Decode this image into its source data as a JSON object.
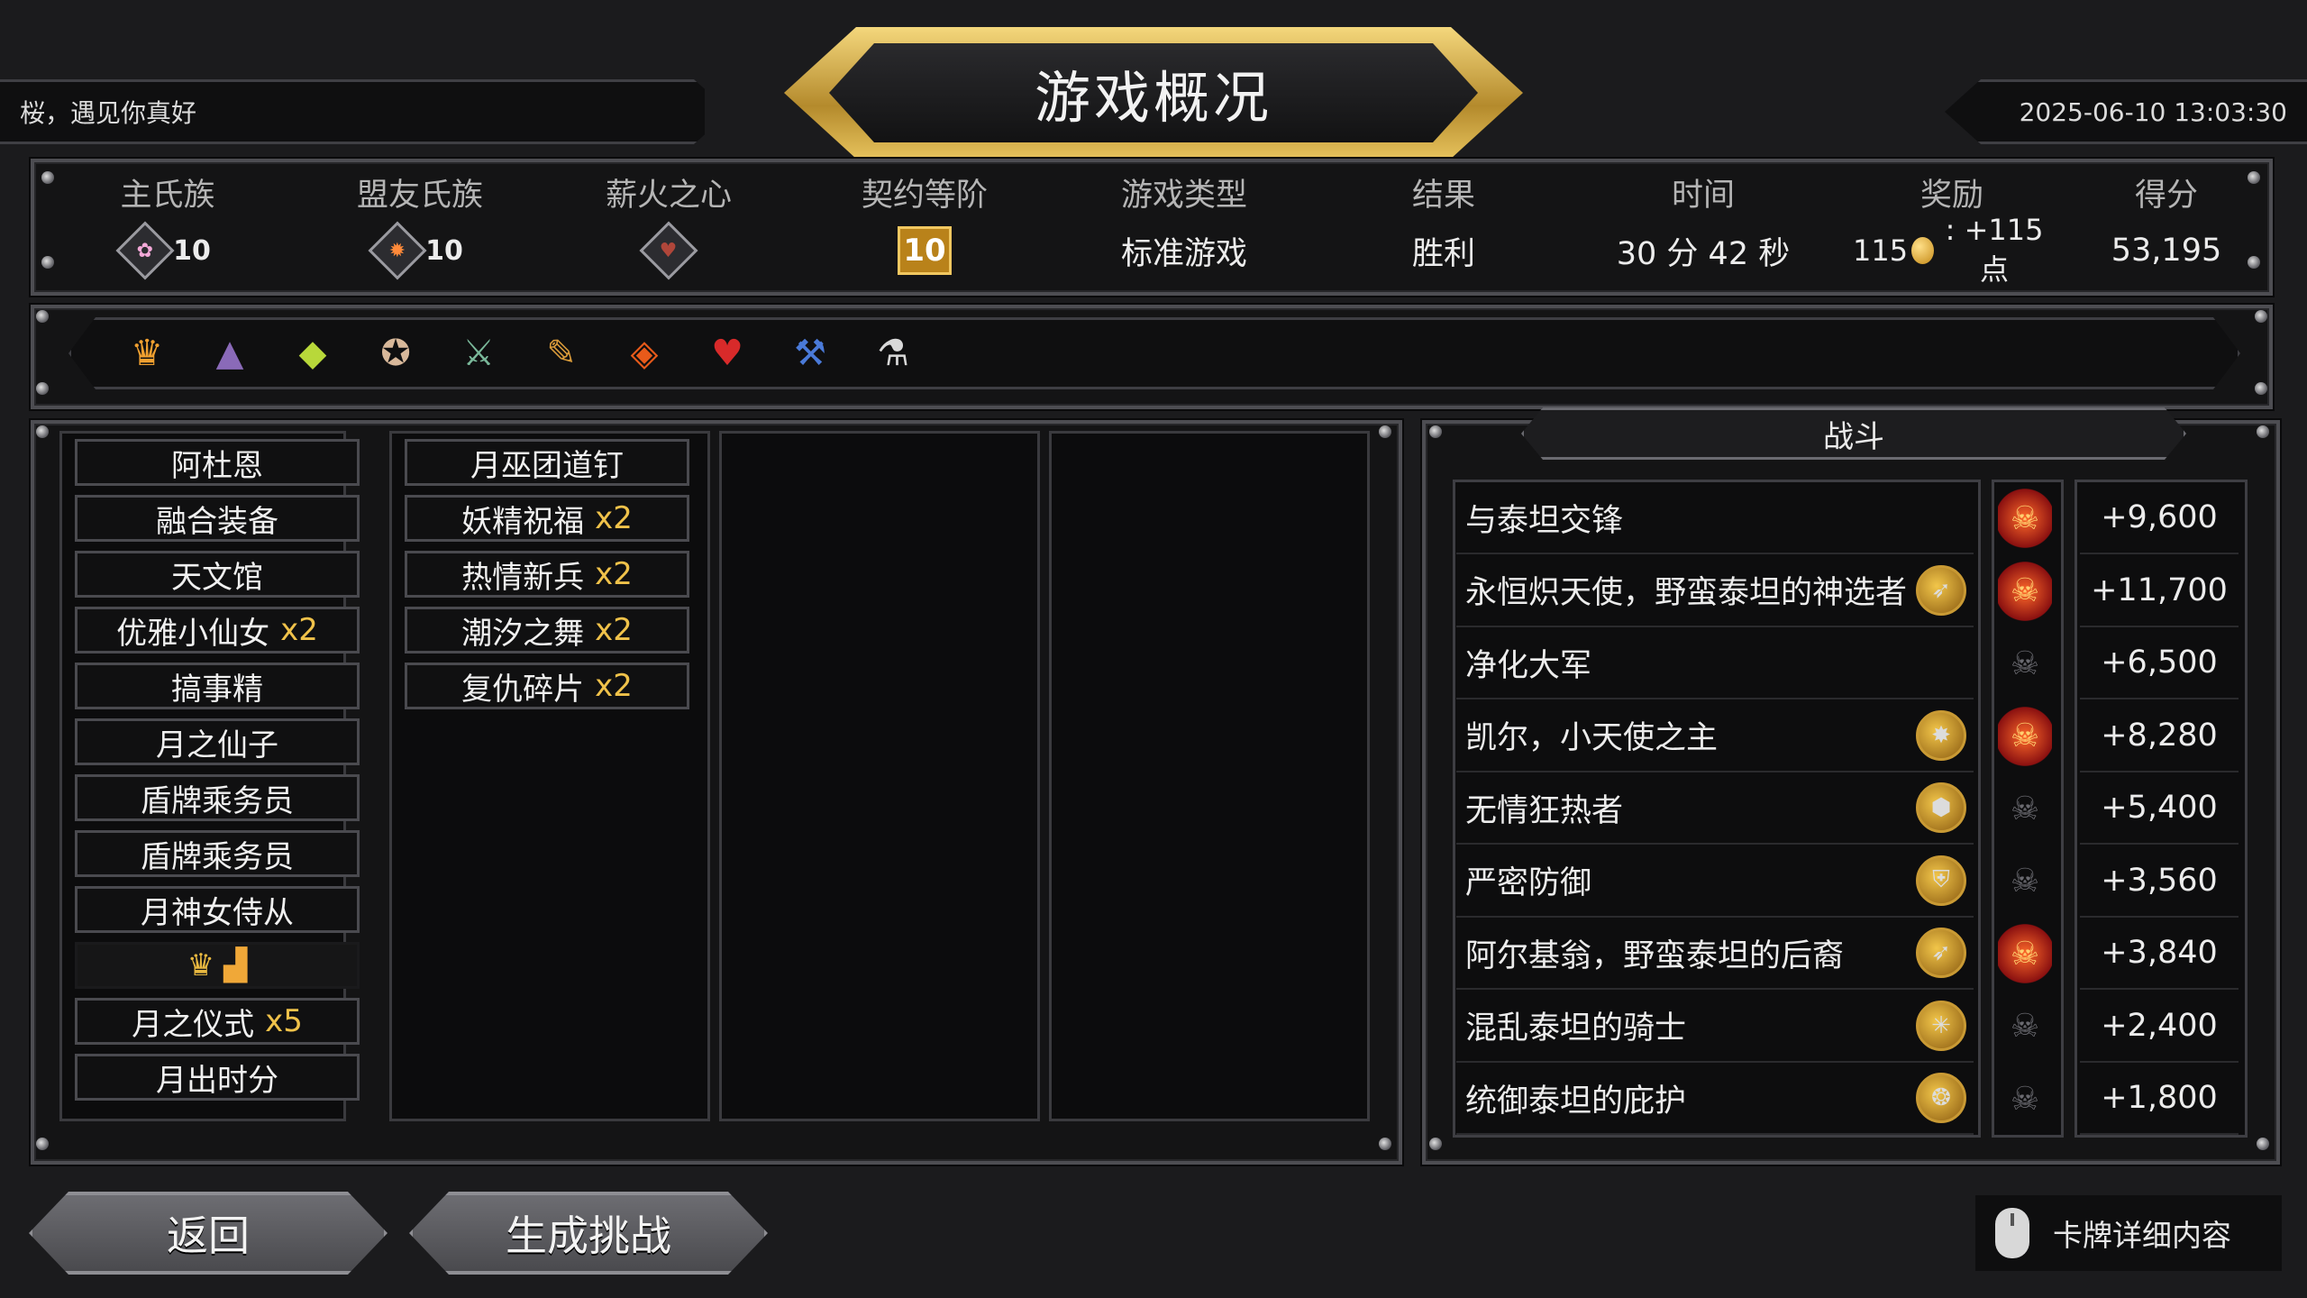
{
  "header": {
    "greeting": "桜，遇见你真好",
    "title": "游戏概况",
    "datetime": "2025-06-10 13:03:30"
  },
  "stats": {
    "main_clan": {
      "label": "主氏族",
      "level": "10",
      "icon": "pink-clan-icon"
    },
    "ally_clan": {
      "label": "盟友氏族",
      "level": "10",
      "icon": "orange-clan-icon"
    },
    "pyre_heart": {
      "label": "薪火之心",
      "icon": "pyre-heart-icon"
    },
    "covenant": {
      "label": "契约等阶",
      "value": "10"
    },
    "game_type": {
      "label": "游戏类型",
      "value": "标准游戏"
    },
    "result": {
      "label": "结果",
      "value": "胜利"
    },
    "time": {
      "label": "时间",
      "value": "30 分 42 秒"
    },
    "reward": {
      "label": "奖励",
      "gold": "115",
      "points": ": +115 点"
    },
    "score": {
      "label": "得分",
      "value": "53,195"
    }
  },
  "relics": [
    "flame-crown-icon",
    "crystal-shard-icon",
    "green-gem-icon",
    "pastry-icon",
    "dagger-icon",
    "wand-icon",
    "ember-card-icon",
    "heart-pendant-icon",
    "anvil-icon",
    "potion-icon"
  ],
  "deck": {
    "col1": [
      {
        "name": "阿杜恩",
        "mult": ""
      },
      {
        "name": "融合装备",
        "mult": ""
      },
      {
        "name": "天文馆",
        "mult": ""
      },
      {
        "name": "优雅小仙女",
        "mult": "x2"
      },
      {
        "name": "搞事精",
        "mult": ""
      },
      {
        "name": "月之仙子",
        "mult": ""
      },
      {
        "name": "盾牌乘务员",
        "mult": ""
      },
      {
        "name": "盾牌乘务员",
        "mult": ""
      },
      {
        "name": "月神女侍从",
        "mult": ""
      },
      {
        "name": "月之仪式",
        "mult": "x5"
      },
      {
        "name": "月出时分",
        "mult": ""
      }
    ],
    "col2": [
      {
        "name": "月巫团道钉",
        "mult": ""
      },
      {
        "name": "妖精祝福",
        "mult": "x2"
      },
      {
        "name": "热情新兵",
        "mult": "x2"
      },
      {
        "name": "潮汐之舞",
        "mult": "x2"
      },
      {
        "name": "复仇碎片",
        "mult": "x2"
      }
    ]
  },
  "battle": {
    "tab": "战斗",
    "rows": [
      {
        "name": "与泰坦交锋",
        "icon": "",
        "skull": "hot",
        "score": "+9,600"
      },
      {
        "name": "永恒炽天使，野蛮泰坦的神选者",
        "icon": "eagle-icon",
        "skull": "hot",
        "score": "+11,700"
      },
      {
        "name": "净化大军",
        "icon": "",
        "skull": "cold",
        "score": "+6,500"
      },
      {
        "name": "凯尔，小天使之主",
        "icon": "burst-icon",
        "skull": "hot",
        "score": "+8,280"
      },
      {
        "name": "无情狂热者",
        "icon": "honeycomb-icon",
        "skull": "cold",
        "score": "+5,400"
      },
      {
        "name": "严密防御",
        "icon": "shield-icon",
        "skull": "cold",
        "score": "+3,560"
      },
      {
        "name": "阿尔基翁，野蛮泰坦的后裔",
        "icon": "eagle-icon",
        "skull": "hot",
        "score": "+3,840"
      },
      {
        "name": "混乱泰坦的骑士",
        "icon": "spider-icon",
        "skull": "cold",
        "score": "+2,400"
      },
      {
        "name": "统御泰坦的庇护",
        "icon": "drop-icon",
        "skull": "cold",
        "score": "+1,800"
      }
    ]
  },
  "footer": {
    "back": "返回",
    "challenge": "生成挑战",
    "details": "卡牌详细内容"
  },
  "colors": {
    "gold": "#f0c24a",
    "frame": "#4d4d52",
    "hot": "#ff6a2a"
  }
}
